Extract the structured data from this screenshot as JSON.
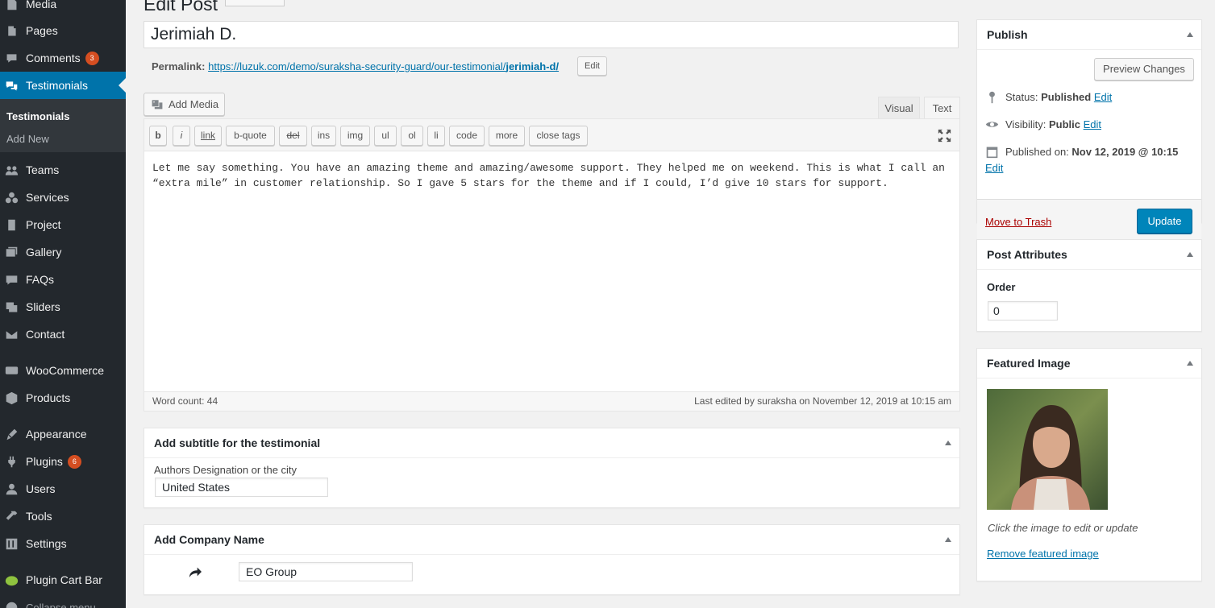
{
  "sidebar": {
    "items": [
      {
        "label": "Media",
        "icon": "media-icon"
      },
      {
        "label": "Pages",
        "icon": "pages-icon"
      },
      {
        "label": "Comments",
        "icon": "comments-icon",
        "badge": "3"
      },
      {
        "label": "Testimonials",
        "icon": "testimonials-icon",
        "active": true
      },
      {
        "label": "Teams",
        "icon": "teams-icon"
      },
      {
        "label": "Services",
        "icon": "services-icon"
      },
      {
        "label": "Project",
        "icon": "project-icon"
      },
      {
        "label": "Gallery",
        "icon": "gallery-icon"
      },
      {
        "label": "FAQs",
        "icon": "faqs-icon"
      },
      {
        "label": "Sliders",
        "icon": "sliders-icon"
      },
      {
        "label": "Contact",
        "icon": "contact-icon"
      },
      {
        "label": "WooCommerce",
        "icon": "woocommerce-icon"
      },
      {
        "label": "Products",
        "icon": "products-icon"
      },
      {
        "label": "Appearance",
        "icon": "appearance-icon"
      },
      {
        "label": "Plugins",
        "icon": "plugins-icon",
        "badge": "6"
      },
      {
        "label": "Users",
        "icon": "users-icon"
      },
      {
        "label": "Tools",
        "icon": "tools-icon"
      },
      {
        "label": "Settings",
        "icon": "settings-icon"
      },
      {
        "label": "Plugin Cart Bar",
        "icon": "plugin-cart-bar-icon"
      },
      {
        "label": "Collapse menu",
        "icon": "collapse-icon"
      }
    ],
    "submenu": [
      "Testimonials",
      "Add New"
    ],
    "accent": "#0073aa"
  },
  "page": {
    "heading_fragment": "Edit Post",
    "title": "Jerimiah D.",
    "permalink_label": "Permalink:",
    "permalink_base": "https://luzuk.com/demo/suraksha-security-guard/our-testimonial/",
    "permalink_slug": "jerimiah-d/",
    "permalink_edit": "Edit"
  },
  "editor": {
    "add_media": "Add Media",
    "tab_visual": "Visual",
    "tab_text": "Text",
    "quicktags": [
      "b",
      "i",
      "link",
      "b-quote",
      "del",
      "ins",
      "img",
      "ul",
      "ol",
      "li",
      "code",
      "more",
      "close tags"
    ],
    "content": "Let me say something. You have an amazing theme and amazing/awesome support. They helped me on weekend. This is what I call an “extra mile” in customer relationship. So I gave 5 stars for the theme and if I could, I’d give 10 stars for support.",
    "word_count": "Word count: 44",
    "last_edited": "Last edited by suraksha on November 12, 2019 at 10:15 am"
  },
  "subtitle_box": {
    "title": "Add subtitle for the testimonial",
    "label": "Authors Designation or the city",
    "value": "United States"
  },
  "company_box": {
    "title": "Add Company Name",
    "value": "EO Group"
  },
  "publish": {
    "title": "Publish",
    "preview": "Preview Changes",
    "status_label": "Status:",
    "status_value": "Published",
    "visibility_label": "Visibility:",
    "visibility_value": "Public",
    "published_label": "Published on:",
    "published_value": "Nov 12, 2019 @ 10:15",
    "edit": "Edit",
    "trash": "Move to Trash",
    "update": "Update"
  },
  "attributes": {
    "title": "Post Attributes",
    "order_label": "Order",
    "order_value": "0"
  },
  "featured": {
    "title": "Featured Image",
    "caption": "Click the image to edit or update",
    "remove": "Remove featured image"
  }
}
